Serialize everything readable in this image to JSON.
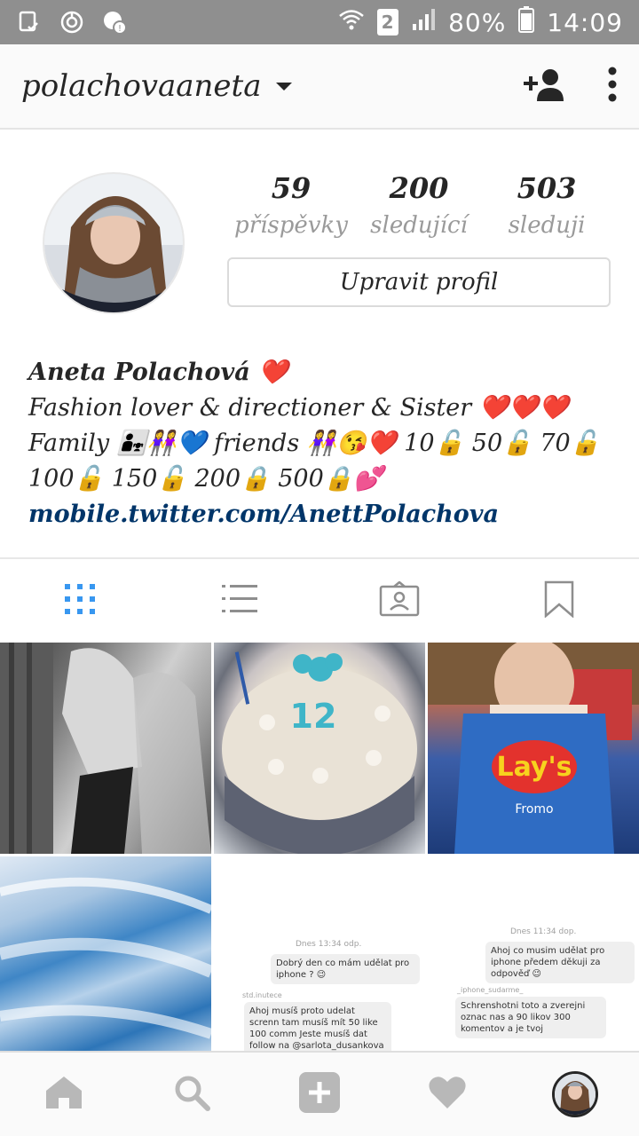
{
  "status_bar": {
    "battery": "80%",
    "time": "14:09",
    "sim_slot": "2",
    "icons": [
      "screenshot-icon",
      "sync-icon",
      "alert-icon",
      "wifi-icon",
      "signal-icon",
      "battery-icon"
    ]
  },
  "header": {
    "username": "polachovaaneta",
    "icons": [
      "chevron-down-icon",
      "add-person-icon",
      "more-vertical-icon"
    ]
  },
  "profile": {
    "stats": [
      {
        "count": "59",
        "label": "příspěvky"
      },
      {
        "count": "200",
        "label": "sledující"
      },
      {
        "count": "503",
        "label": "sleduji"
      }
    ],
    "edit_button": "Upravit profil"
  },
  "bio": {
    "name": "Aneta Polachová ❤️",
    "line1": "Fashion lover & directioner & Sister ❤️❤️❤️",
    "line2": "Family 👨‍👧👭💙 friends 👭😘❤️ 10🔓 50🔓 70🔓",
    "line3": "100🔓 150🔓 200🔒  500🔒💕",
    "link": "mobile.twitter.com/AnettPolachova"
  },
  "tabs": [
    {
      "name": "grid",
      "icon": "grid-icon",
      "active": true
    },
    {
      "name": "list",
      "icon": "list-icon",
      "active": false
    },
    {
      "name": "tagged",
      "icon": "tagged-photo-icon",
      "active": false
    },
    {
      "name": "saved",
      "icon": "bookmark-icon",
      "active": false
    }
  ],
  "grid": {
    "cake_number": "12",
    "chips_brand": "Lay's",
    "chips_flavor": "Fromo",
    "chat_left": {
      "time": "Dnes 13:34 odp.",
      "bubble1": "Dobrý den co mám udělat pro iphone ? 😉",
      "sender": "std.inutece",
      "bubble2": "Ahoj musíš proto udelat screnn tam musíš mít 50 like 100 comm Jeste musíš dat follow na @sarlota_dusankova a"
    },
    "chat_right": {
      "time": "Dnes 11:34 dop.",
      "bubble1": "Ahoj co musim udělat pro iphone předem děkuji za odpověď 😉",
      "sender": "_iphone_sudarme_",
      "bubble2": "Schrenshotni toto a zverejni oznac nas a 90 likov 300 komentov a je tvoj"
    }
  },
  "bottom_nav": [
    {
      "name": "home",
      "icon": "home-icon"
    },
    {
      "name": "search",
      "icon": "search-icon"
    },
    {
      "name": "add",
      "icon": "add-post-icon"
    },
    {
      "name": "activity",
      "icon": "heart-icon"
    },
    {
      "name": "profile",
      "icon": "profile-avatar"
    }
  ],
  "colors": {
    "status_bar": "#8f8f8f",
    "accent_blue": "#3897f0",
    "link": "#003569",
    "muted": "#9a9a9a"
  }
}
